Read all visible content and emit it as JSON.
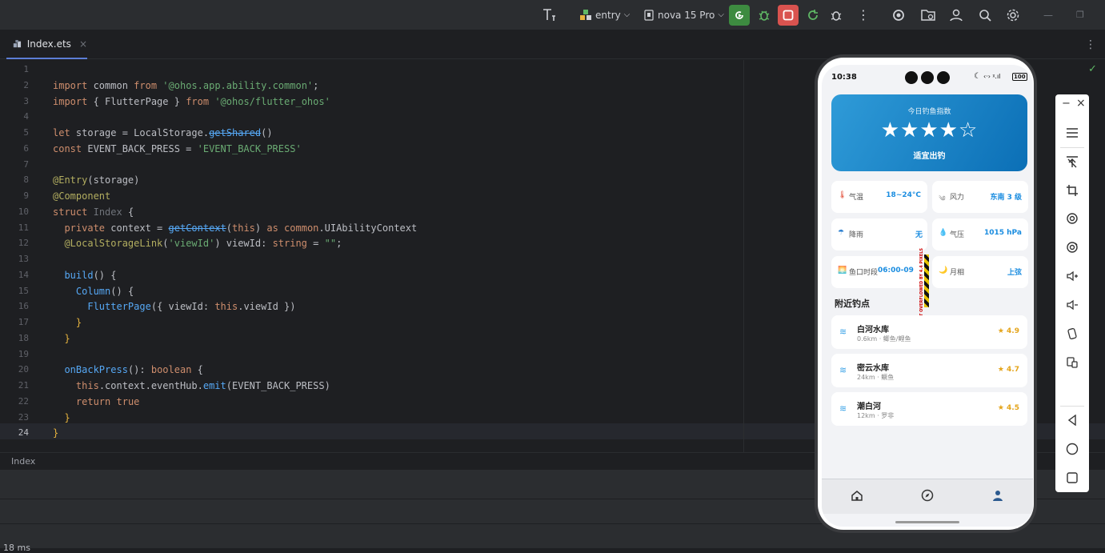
{
  "toolbar": {
    "module": "entry",
    "device": "nova 15 Pro",
    "colors": {
      "run": "#3d8b40",
      "stop": "#d9534f"
    }
  },
  "tab": {
    "filename": "Index.ets",
    "close": "×"
  },
  "editor": {
    "line_numbers": [
      "1",
      "2",
      "3",
      "4",
      "5",
      "6",
      "7",
      "8",
      "9",
      "10",
      "11",
      "12",
      "13",
      "14",
      "15",
      "16",
      "17",
      "18",
      "19",
      "20",
      "21",
      "22",
      "23",
      "24"
    ],
    "breadcrumb": "Index"
  },
  "code": {
    "l2": [
      "import",
      " common ",
      "from",
      " ",
      "'@ohos.app.ability.common'",
      ";"
    ],
    "l3": [
      "import",
      " { FlutterPage } ",
      "from",
      " ",
      "'@ohos/flutter_ohos'"
    ],
    "l5": [
      "let",
      " storage = LocalStorage.",
      "getShared",
      "()"
    ],
    "l6": [
      "const",
      " EVENT_BACK_PRESS = ",
      "'EVENT_BACK_PRESS'"
    ],
    "l8": [
      "@Entry",
      "(storage)"
    ],
    "l9": [
      "@Component"
    ],
    "l10": [
      "struct",
      " ",
      "Index",
      " {"
    ],
    "l11": [
      "  ",
      "private",
      " context = ",
      "getContext",
      "(",
      "this",
      ") ",
      "as",
      " ",
      "common",
      ".UIAbilityContext"
    ],
    "l12": [
      "  ",
      "@LocalStorageLink",
      "(",
      "'viewId'",
      ") viewId: ",
      "string",
      " = ",
      "\"\"",
      ";"
    ],
    "l14": [
      "  ",
      "build",
      "() {"
    ],
    "l15": [
      "    ",
      "Column",
      "() {"
    ],
    "l16": [
      "      ",
      "FlutterPage",
      "({ viewId: ",
      "this",
      ".viewId })"
    ],
    "l17": [
      "    }"
    ],
    "l18": [
      "  }"
    ],
    "l20": [
      "  ",
      "onBackPress",
      "(): ",
      "boolean",
      " {"
    ],
    "l21": [
      "    ",
      "this",
      ".context.eventHub.",
      "emit",
      "(EVENT_BACK_PRESS)"
    ],
    "l22": [
      "    ",
      "return",
      " ",
      "true"
    ],
    "l23": [
      "  }"
    ],
    "l24": [
      "}"
    ]
  },
  "bottom": {
    "timing": "18 ms"
  },
  "phone": {
    "time": "10:38",
    "battery": "100",
    "hero": {
      "title": "今日钓鱼指数",
      "stars": "★★★★☆",
      "subtitle": "适宜出钓"
    },
    "cards": [
      {
        "label": "气温",
        "value": "18~24°C"
      },
      {
        "label": "风力",
        "value": "东南 3 级"
      },
      {
        "label": "降雨",
        "value": "无"
      },
      {
        "label": "气压",
        "value": "1015 hPa"
      },
      {
        "label": "鱼口时段",
        "value": "06:00-09"
      },
      {
        "label": "月相",
        "value": "上弦"
      }
    ],
    "overflow_text": "RIGHT OVERFLOWED BY 4.4 PIXELS",
    "section_title": "附近钓点",
    "spots": [
      {
        "name": "白河水库",
        "meta": "0.6km · 鲫鱼/鲤鱼",
        "rating": "4.9"
      },
      {
        "name": "密云水库",
        "meta": "24km · 鳜鱼",
        "rating": "4.7"
      },
      {
        "name": "潮白河",
        "meta": "12km · 罗非",
        "rating": "4.5"
      }
    ]
  },
  "sidetools": {
    "minimize": "−",
    "close": "×"
  }
}
